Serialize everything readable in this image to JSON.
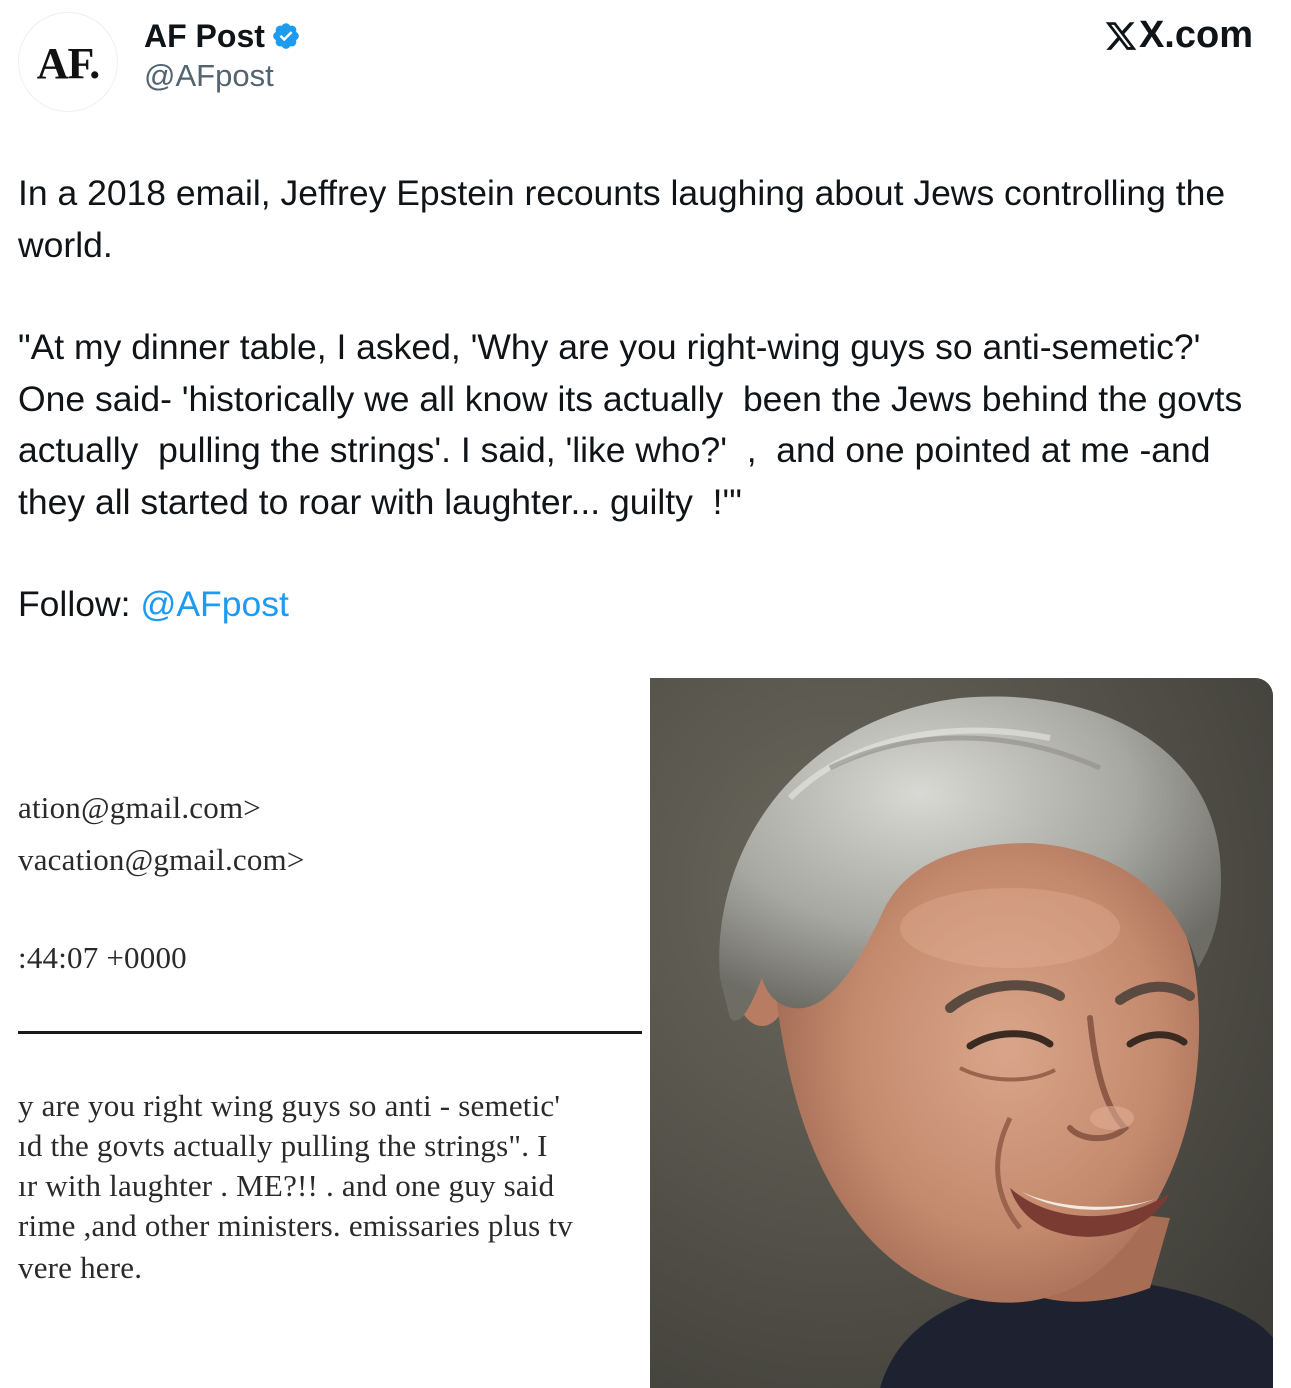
{
  "header": {
    "avatar_text": "AF.",
    "display_name": "AF Post",
    "handle": "@AFpost",
    "site": "X.com",
    "icons": {
      "verified": "verified-badge-icon",
      "site_logo": "x-logo-icon"
    }
  },
  "tweet": {
    "line1": "In a 2018 email, Jeffrey Epstein recounts laughing about Jews controlling the world.",
    "quote": "\"At my dinner table, I asked, 'Why are you right-wing guys so anti-semetic?' One said- 'historically we all know its actually  been the Jews behind the govts actually  pulling the strings'. I said, 'like who?'  ,  and one pointed at me -and they all started to roar with laughter... guilty  !'\"",
    "follow_label": "Follow: ",
    "follow_mention": "@AFpost"
  },
  "document_image": {
    "lines": [
      "ation@gmail.com>",
      "vacation@gmail.com>",
      ":44:07 +0000",
      "y are you right wing guys so anti - semetic'",
      "ıd the govts actually  pulling the strings\".  I",
      "ır with laughter .   ME?!! . and one guy said",
      "rime ,and other ministers. emissaries plus tv",
      "vere here."
    ]
  },
  "colors": {
    "text": "#0f1419",
    "secondary": "#536471",
    "link": "#1d9bf0",
    "verified": "#1d9bf0"
  }
}
